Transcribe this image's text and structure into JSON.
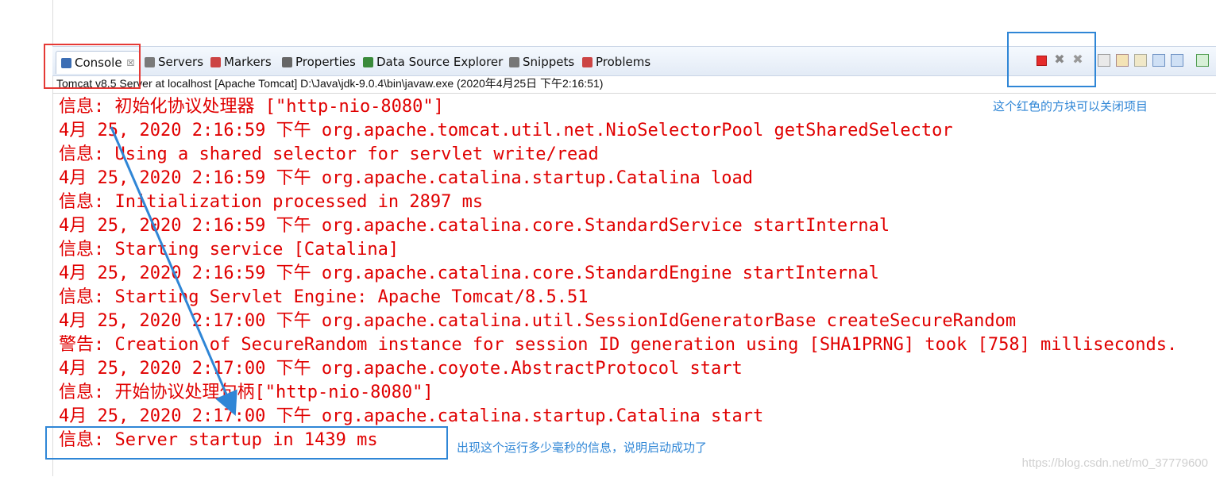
{
  "tabs": [
    {
      "label": "Console",
      "icon": "console-icon",
      "color": "#3c6eb4"
    },
    {
      "label": "Servers",
      "icon": "servers-icon",
      "color": "#7a7a7a"
    },
    {
      "label": "Markers",
      "icon": "markers-icon",
      "color": "#c44"
    },
    {
      "label": "Properties",
      "icon": "properties-icon",
      "color": "#666"
    },
    {
      "label": "Data Source Explorer",
      "icon": "data-source-icon",
      "color": "#3a8a3a"
    },
    {
      "label": "Snippets",
      "icon": "snippets-icon",
      "color": "#777"
    },
    {
      "label": "Problems",
      "icon": "problems-icon",
      "color": "#c44"
    }
  ],
  "console": {
    "description": "Tomcat v8.5 Server at localhost [Apache Tomcat] D:\\Java\\jdk-9.0.4\\bin\\javaw.exe (2020年4月25日 下午2:16:51)",
    "lines": [
      "信息: 初始化协议处理器 [\"http-nio-8080\"]",
      "4月 25, 2020 2:16:59 下午 org.apache.tomcat.util.net.NioSelectorPool getSharedSelector",
      "信息: Using a shared selector for servlet write/read",
      "4月 25, 2020 2:16:59 下午 org.apache.catalina.startup.Catalina load",
      "信息: Initialization processed in 2897 ms",
      "4月 25, 2020 2:16:59 下午 org.apache.catalina.core.StandardService startInternal",
      "信息: Starting service [Catalina]",
      "4月 25, 2020 2:16:59 下午 org.apache.catalina.core.StandardEngine startInternal",
      "信息: Starting Servlet Engine: Apache Tomcat/8.5.51",
      "4月 25, 2020 2:17:00 下午 org.apache.catalina.util.SessionIdGeneratorBase createSecureRandom",
      "警告: Creation of SecureRandom instance for session ID generation using [SHA1PRNG] took [758] milliseconds.",
      "4月 25, 2020 2:17:00 下午 org.apache.coyote.AbstractProtocol start",
      "信息: 开始协议处理句柄[\"http-nio-8080\"]",
      "4月 25, 2020 2:17:00 下午 org.apache.catalina.startup.Catalina start",
      "信息: Server startup in 1439 ms"
    ]
  },
  "toolbar": {
    "icons": [
      "terminate-icon",
      "remove-launch-icon",
      "remove-all-terminated-icon",
      "clear-console-icon",
      "scroll-lock-icon",
      "word-wrap-icon",
      "show-on-output-icon",
      "show-on-error-icon",
      "pin-console-icon"
    ]
  },
  "annotations": {
    "stop_note": "这个红色的方块可以关闭项目",
    "startup_note": "出现这个运行多少毫秒的信息，说明启动成功了"
  },
  "watermark": "https://blog.csdn.net/m0_37779600",
  "colors": {
    "console_text": "#e00000",
    "annotation_blue": "#2f86d6",
    "highlight_red": "#e53935"
  }
}
